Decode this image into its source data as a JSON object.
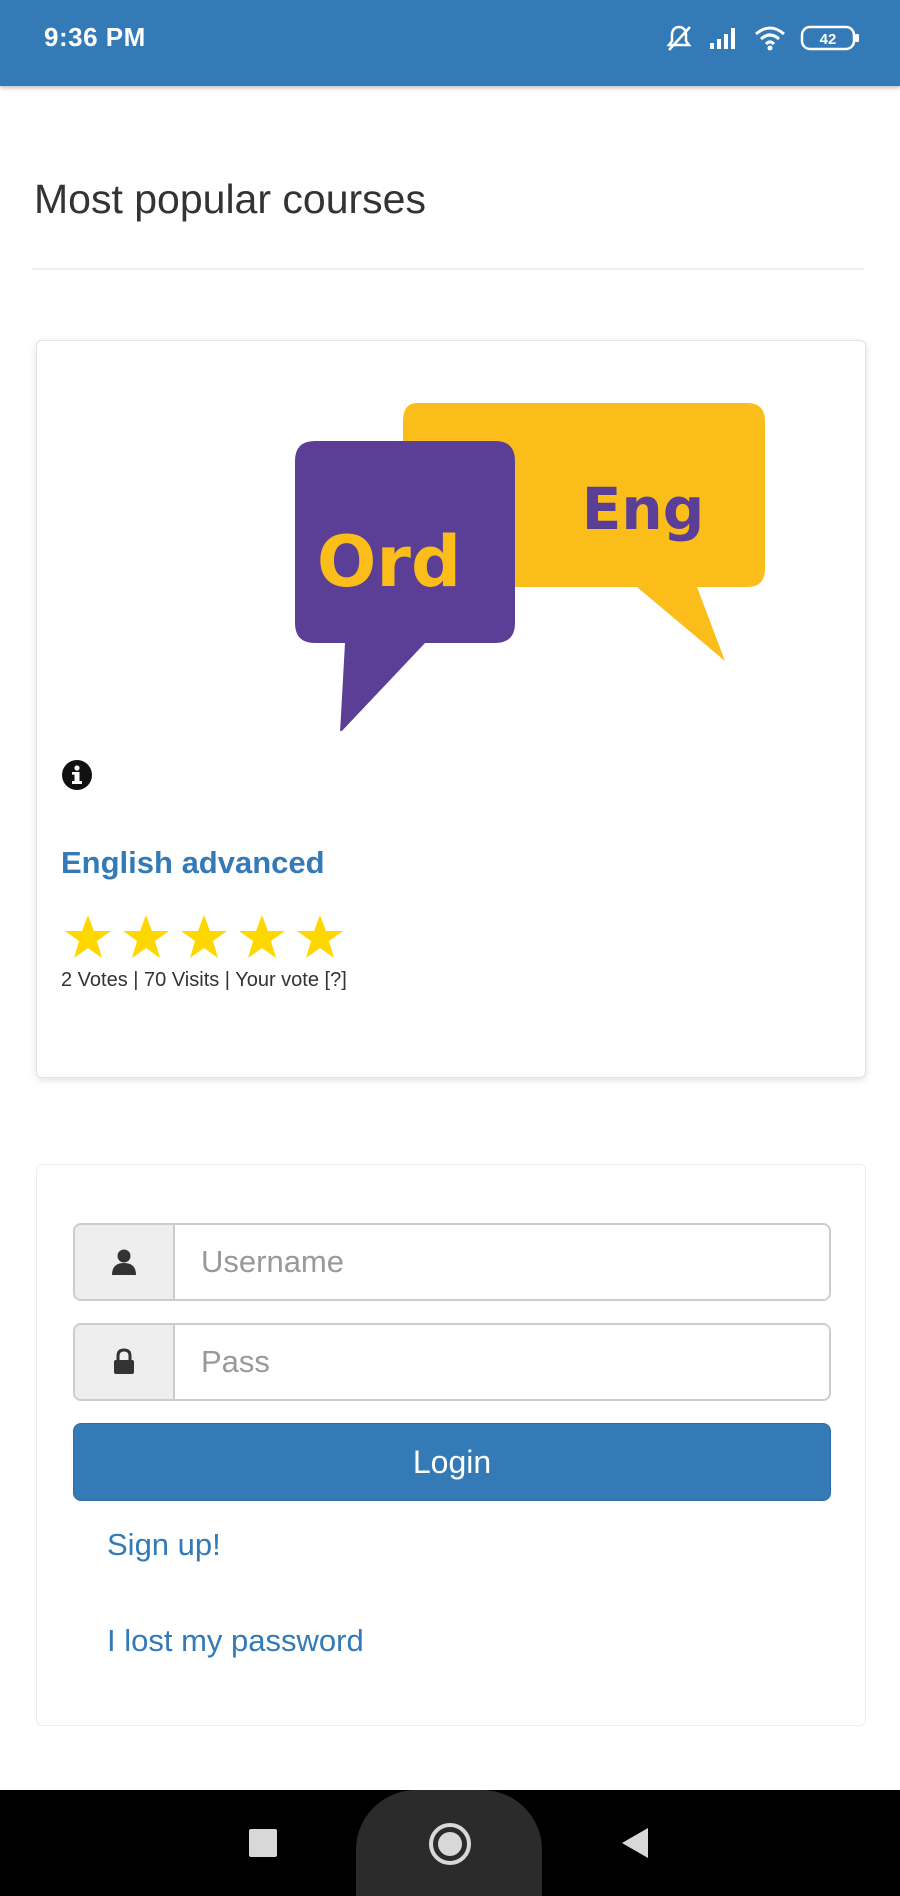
{
  "status_bar": {
    "time": "9:36 PM",
    "battery": "42",
    "icons": [
      "notifications-off-icon",
      "signal-icon",
      "wifi-icon",
      "battery-icon"
    ],
    "color": "#337ab7"
  },
  "page": {
    "title": "Most popular courses"
  },
  "course": {
    "logo": {
      "icon": "ordeng-logo-icon",
      "left_text": "Ord",
      "right_text": "Eng",
      "purple": "#5b3f96",
      "yellow": "#fbbd1a"
    },
    "info_icon": "info-circle-icon",
    "title": "English advanced",
    "rating": 5,
    "rating_max": 5,
    "star_color": "#ffd700",
    "stats": "2 Votes | 70 Visits | Your vote [?]"
  },
  "login": {
    "username_placeholder": "Username",
    "username_icon": "user-icon",
    "password_placeholder": "Pass",
    "password_icon": "lock-icon",
    "login_label": "Login",
    "signup_label": "Sign up!",
    "lost_password_label": "I lost my password",
    "accent": "#337ab7"
  },
  "nav": {
    "icons": [
      "recents-square-icon",
      "home-circle-icon",
      "back-triangle-icon"
    ]
  }
}
